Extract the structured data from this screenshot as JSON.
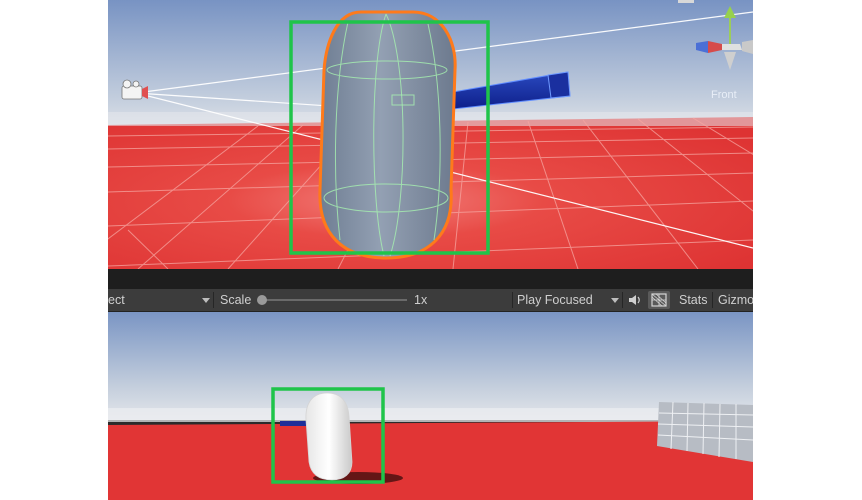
{
  "scene": {
    "orientation_label": "Front",
    "ground_color": "#e23c3c",
    "selection_color": "#1fc44a"
  },
  "toolbar": {
    "aspect_dropdown": "ect",
    "scale_label": "Scale",
    "scale_value": "1x",
    "play_mode_dropdown": "Play Focused",
    "stats_label": "Stats",
    "gizmos_label": "Gizmo"
  },
  "icons": {
    "audio": "speaker-icon",
    "stats_toggle": "grid-icon",
    "camera": "camera-icon",
    "gizmo": "axis-gizmo-icon"
  }
}
